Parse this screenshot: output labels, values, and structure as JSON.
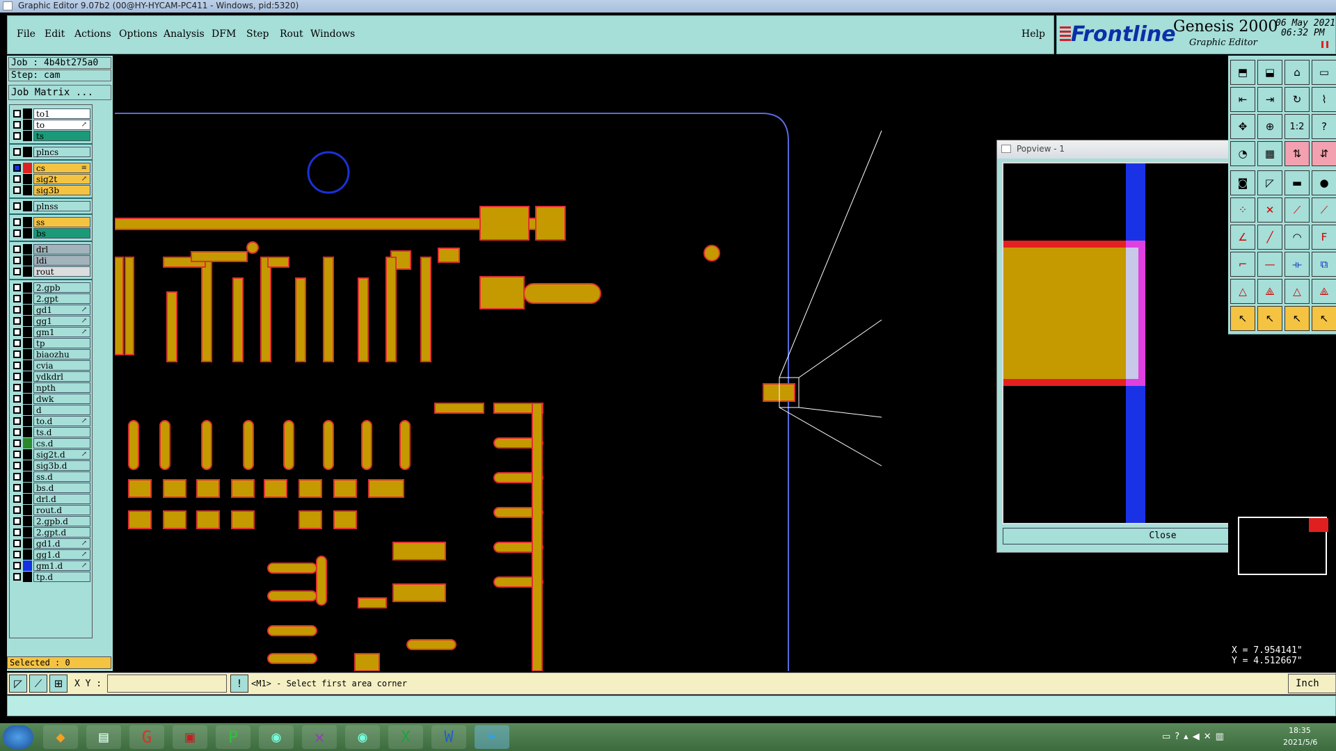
{
  "window": {
    "title": "Graphic Editor 9.07b2 (00@HY-HYCAM-PC411 - Windows, pid:5320)"
  },
  "menu": {
    "items": [
      "File",
      "Edit",
      "Actions",
      "Options",
      "Analysis",
      "DFM",
      "Step",
      "Rout",
      "Windows"
    ],
    "help": "Help"
  },
  "brand": {
    "logo": "Frontline",
    "product": "Genesis 2000",
    "subtitle": "Graphic Editor",
    "date": "06 May 2021",
    "time": "06:32 PM"
  },
  "job": {
    "name": "Job : 4b4bt275a0",
    "step": "Step: cam",
    "matrix_button": "Job Matrix ..."
  },
  "layers": [
    {
      "name": "to1",
      "color": "#ffffff",
      "group": 1
    },
    {
      "name": "to",
      "color": "#ffffff",
      "group": 1,
      "mark": "↗"
    },
    {
      "name": "ts",
      "color": "#1a9a77",
      "group": 1
    },
    {
      "name": "plncs",
      "color": "#a6ded8",
      "group": 2
    },
    {
      "name": "cs",
      "color": "#f5c342",
      "group": 3,
      "swatch": "#e02020",
      "checked": true,
      "mark": "≡"
    },
    {
      "name": "sig2t",
      "color": "#f5c342",
      "group": 3,
      "mark": "↗"
    },
    {
      "name": "sig3b",
      "color": "#f5c342",
      "group": 3
    },
    {
      "name": "plnss",
      "color": "#a6ded8",
      "group": 4
    },
    {
      "name": "ss",
      "color": "#f5c342",
      "group": 5
    },
    {
      "name": "bs",
      "color": "#1a9a77",
      "group": 5
    },
    {
      "name": "drl",
      "color": "#a3b3bb",
      "group": 6
    },
    {
      "name": "ldi",
      "color": "#a3b3bb",
      "group": 6
    },
    {
      "name": "rout",
      "color": "#dddddd",
      "group": 6
    },
    {
      "name": "2.gpb",
      "color": "#a6ded8",
      "group": 7
    },
    {
      "name": "2.gpt",
      "color": "#a6ded8",
      "group": 7
    },
    {
      "name": "gd1",
      "color": "#a6ded8",
      "group": 7,
      "mark": "↗"
    },
    {
      "name": "gg1",
      "color": "#a6ded8",
      "group": 7,
      "mark": "↗"
    },
    {
      "name": "gm1",
      "color": "#a6ded8",
      "group": 7,
      "mark": "↗"
    },
    {
      "name": "tp",
      "color": "#a6ded8",
      "group": 7
    },
    {
      "name": "biaozhu",
      "color": "#a6ded8",
      "group": 7
    },
    {
      "name": "cvia",
      "color": "#a6ded8",
      "group": 7
    },
    {
      "name": "ydkdrl",
      "color": "#a6ded8",
      "group": 7
    },
    {
      "name": "npth",
      "color": "#a6ded8",
      "group": 7
    },
    {
      "name": "dwk",
      "color": "#a6ded8",
      "group": 7
    },
    {
      "name": "d",
      "color": "#a6ded8",
      "group": 7
    },
    {
      "name": "to.d",
      "color": "#a6ded8",
      "group": 7,
      "mark": "↗"
    },
    {
      "name": "ts.d",
      "color": "#a6ded8",
      "group": 7
    },
    {
      "name": "cs.d",
      "color": "#a6ded8",
      "group": 7,
      "swatch": "#2a8a2a"
    },
    {
      "name": "sig2t.d",
      "color": "#a6ded8",
      "group": 7,
      "mark": "↗"
    },
    {
      "name": "sig3b.d",
      "color": "#a6ded8",
      "group": 7
    },
    {
      "name": "ss.d",
      "color": "#a6ded8",
      "group": 7
    },
    {
      "name": "bs.d",
      "color": "#a6ded8",
      "group": 7
    },
    {
      "name": "drl.d",
      "color": "#a6ded8",
      "group": 7
    },
    {
      "name": "rout.d",
      "color": "#a6ded8",
      "group": 7
    },
    {
      "name": "2.gpb.d",
      "color": "#a6ded8",
      "group": 7
    },
    {
      "name": "2.gpt.d",
      "color": "#a6ded8",
      "group": 7
    },
    {
      "name": "gd1.d",
      "color": "#a6ded8",
      "group": 7,
      "mark": "↗"
    },
    {
      "name": "gg1.d",
      "color": "#a6ded8",
      "group": 7,
      "mark": "↗"
    },
    {
      "name": "gm1.d",
      "color": "#a6ded8",
      "group": 7,
      "swatch": "#1530e0",
      "mark": "↗"
    },
    {
      "name": "tp.d",
      "color": "#a6ded8",
      "group": 7
    }
  ],
  "popview": {
    "title": "Popview - 1",
    "close_label": "Close",
    "close_x": "✕"
  },
  "selected": "Selected : 0",
  "coords": {
    "x": "X = 7.954141\"",
    "y": "Y = 4.512667\""
  },
  "bottom": {
    "xy_label": "X Y :",
    "xy_value": "",
    "prompt": "<M1> - Select first area corner",
    "units": "Inch"
  },
  "taskbar": {
    "time": "18:35",
    "date": "2021/5/6"
  },
  "colors": {
    "panel": "#a6ded8",
    "copper": "#c49a00",
    "outline": "#e03030",
    "profile": "#4a5ad8"
  }
}
